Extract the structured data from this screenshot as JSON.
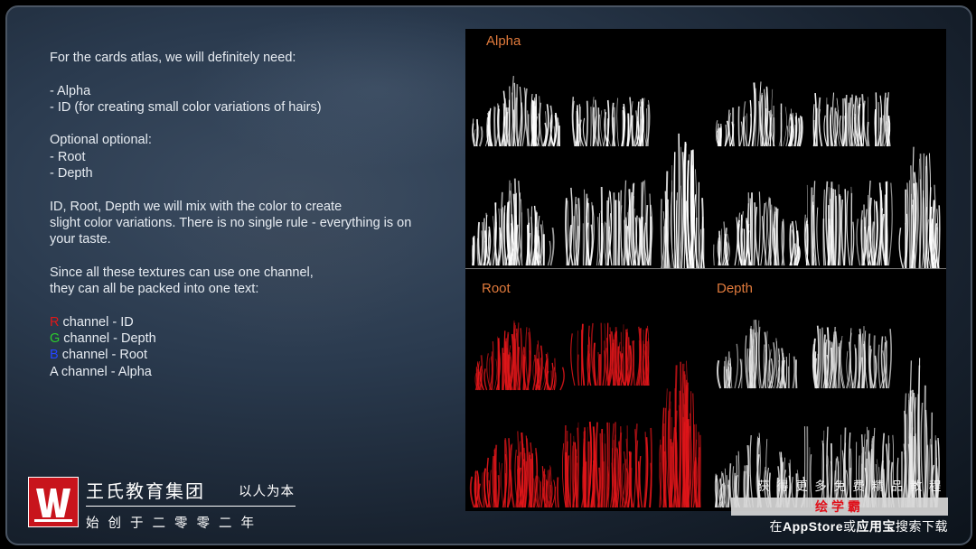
{
  "text": {
    "line1": "For the cards atlas, we will definitely need:",
    "line2": "- Alpha",
    "line3": "- ID (for creating small color variations of hairs)",
    "line4": "Optional optional:",
    "line5": "- Root",
    "line6": "- Depth",
    "line7": "ID, Root, Depth we will mix with the color to create",
    "line8": "slight color variations. There is no single rule - everything is on",
    "line9": "your taste.",
    "line10": "Since all these textures can use one channel,",
    "line11": "they can all be packed into one text:",
    "channels": [
      {
        "letter": "R",
        "rest": " channel - ID"
      },
      {
        "letter": "G",
        "rest": " channel - Depth"
      },
      {
        "letter": "B",
        "rest": " channel - Root"
      },
      {
        "letter": "A",
        "rest": " channel - Alpha"
      }
    ]
  },
  "atlas": {
    "labels": {
      "alpha": "Alpha",
      "root": "Root",
      "depth": "Depth"
    },
    "colors": {
      "label": "#e07a3c",
      "alpha": "#ffffff",
      "root": "#e0161a",
      "depth": "#e8e8e8"
    }
  },
  "branding": {
    "org_name": "王氏教育集团",
    "motto": "以人为本",
    "founded": "始创于二零零二年"
  },
  "promo": {
    "top": "获得更多免费精品教程",
    "badge": "绘学霸",
    "bottom_prefix": "在",
    "bottom_store": "AppStore",
    "bottom_or": "或",
    "bottom_app": "应用宝",
    "bottom_suffix": "搜索下载"
  }
}
